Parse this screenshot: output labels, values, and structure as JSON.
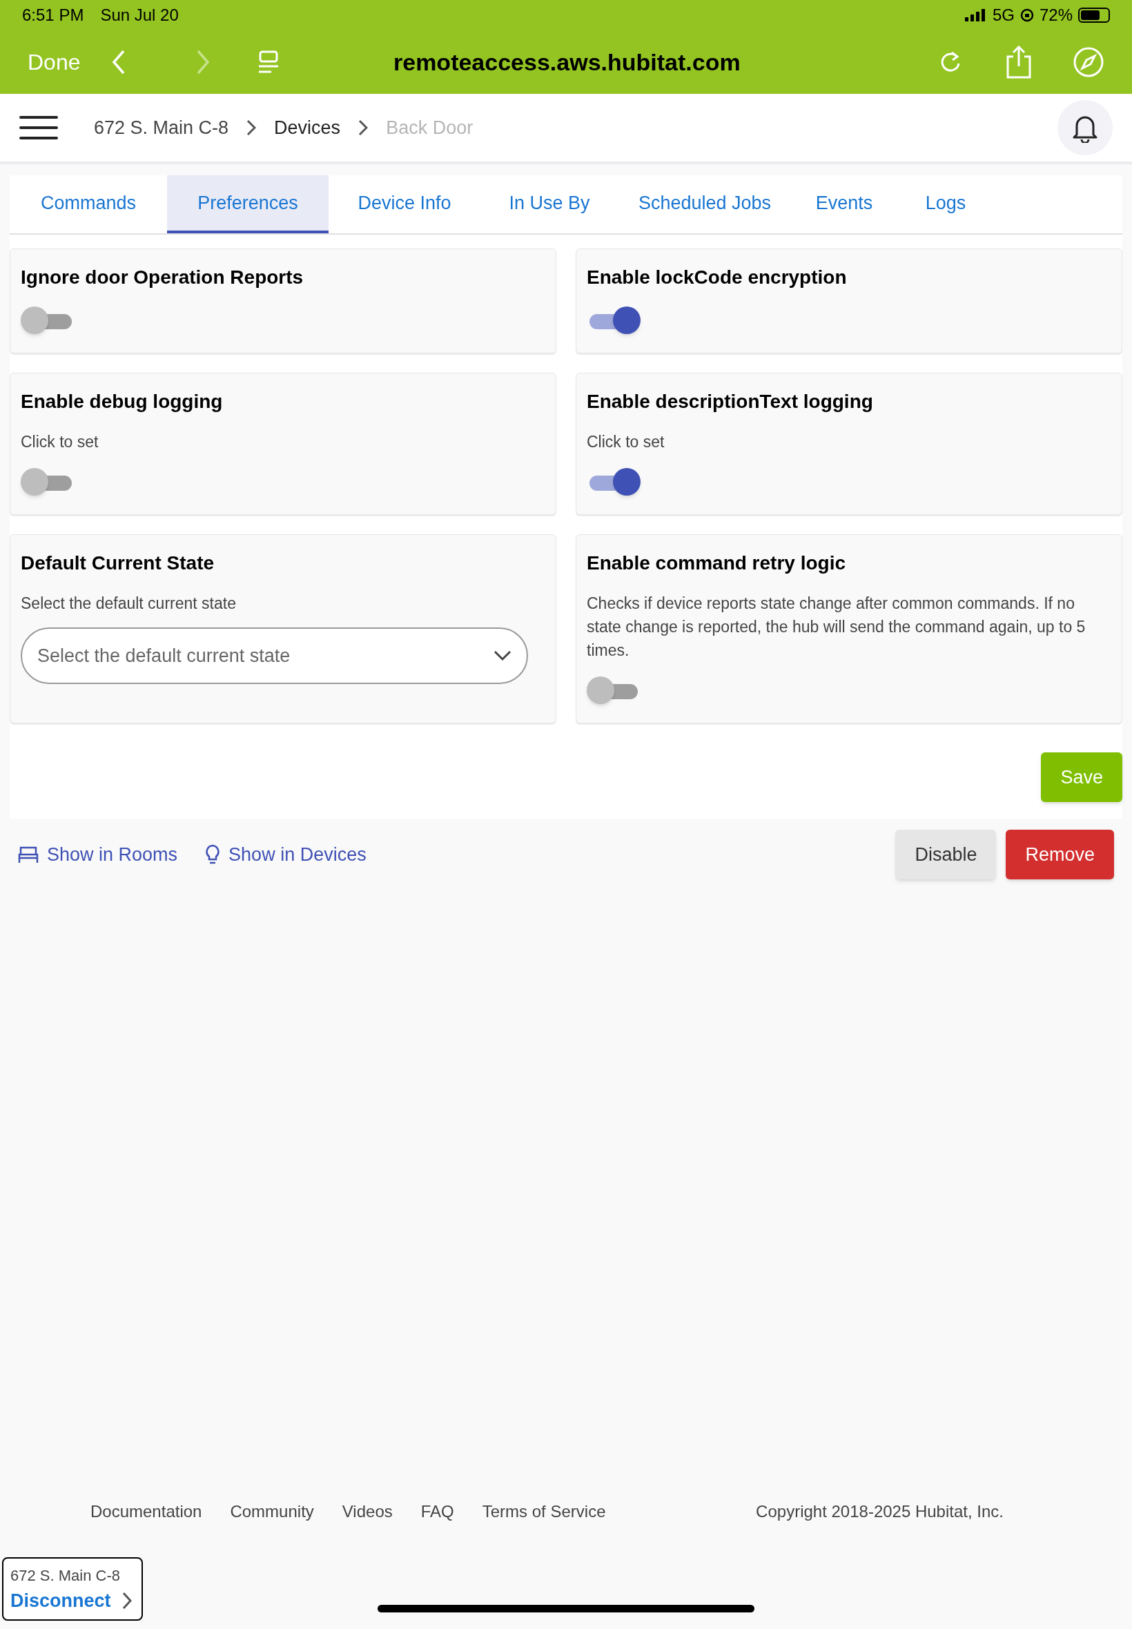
{
  "status_bar": {
    "time": "6:51 PM",
    "date": "Sun Jul 20",
    "network": "5G",
    "battery": "72%"
  },
  "browser": {
    "done": "Done",
    "url": "remoteaccess.aws.hubitat.com",
    "forward_disabled": true
  },
  "breadcrumbs": [
    {
      "label": "672 S. Main C-8",
      "current": false
    },
    {
      "label": "Devices",
      "current": false
    },
    {
      "label": "Back Door",
      "current": true
    }
  ],
  "tabs": [
    {
      "label": "Commands",
      "selected": false
    },
    {
      "label": "Preferences",
      "selected": true
    },
    {
      "label": "Device Info",
      "selected": false
    },
    {
      "label": "In Use By",
      "selected": false
    },
    {
      "label": "Scheduled Jobs",
      "selected": false
    },
    {
      "label": "Events",
      "selected": false
    },
    {
      "label": "Logs",
      "selected": false
    }
  ],
  "preferences": [
    {
      "kind": "toggle",
      "title": "Ignore door Operation Reports",
      "on": false
    },
    {
      "kind": "toggle",
      "title": "Enable lockCode encryption",
      "on": true
    },
    {
      "kind": "toggle",
      "title": "Enable debug logging",
      "description": "Click to set",
      "on": false
    },
    {
      "kind": "toggle",
      "title": "Enable descriptionText logging",
      "description": "Click to set",
      "on": true
    },
    {
      "kind": "select",
      "title": "Default Current State",
      "description": "Select the default current state",
      "placeholder": "Select the default current state"
    },
    {
      "kind": "toggle",
      "title": "Enable command retry logic",
      "description": "Checks if device reports state change after common commands. If no state change is reported, the hub will send the command again, up to 5 times.",
      "on": false
    }
  ],
  "save_button": "Save",
  "links": [
    {
      "kind": "rooms",
      "label": "Show in Rooms"
    },
    {
      "kind": "devices",
      "label": "Show in Devices"
    }
  ],
  "actions": [
    {
      "kind": "neutral",
      "label": "Disable"
    },
    {
      "kind": "danger",
      "label": "Remove"
    }
  ],
  "footer_links": [
    "Documentation",
    "Community",
    "Videos",
    "FAQ",
    "Terms of Service"
  ],
  "copyright": "Copyright 2018-2025 Hubitat, Inc.",
  "connection": {
    "hub": "672 S. Main C-8",
    "action": "Disconnect"
  }
}
